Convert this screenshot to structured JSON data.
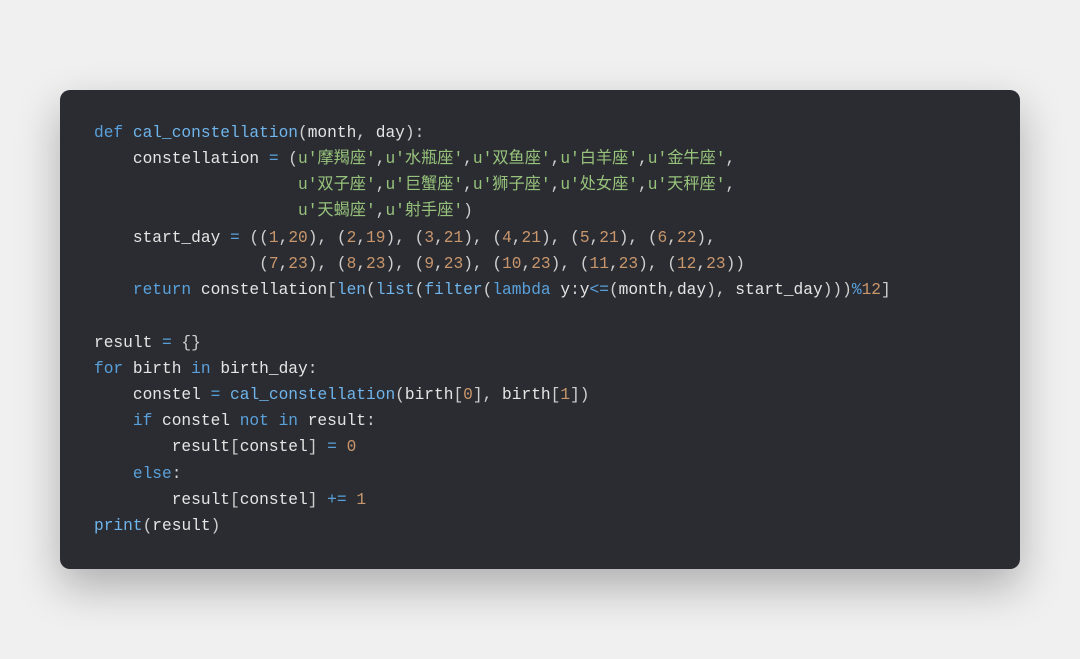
{
  "code": {
    "lines": [
      [
        {
          "cls": "t-def",
          "t": "def "
        },
        {
          "cls": "t-fn",
          "t": "cal_constellation"
        },
        {
          "cls": "t-punc",
          "t": "("
        },
        {
          "cls": "t-param",
          "t": "month"
        },
        {
          "cls": "t-punc",
          "t": ", "
        },
        {
          "cls": "t-param",
          "t": "day"
        },
        {
          "cls": "t-punc",
          "t": "):"
        }
      ],
      [
        {
          "cls": "t-var",
          "t": "    constellation "
        },
        {
          "cls": "t-op",
          "t": "="
        },
        {
          "cls": "t-punc",
          "t": " ("
        },
        {
          "cls": "t-str",
          "t": "u'摩羯座'"
        },
        {
          "cls": "t-punc",
          "t": ","
        },
        {
          "cls": "t-str",
          "t": "u'水瓶座'"
        },
        {
          "cls": "t-punc",
          "t": ","
        },
        {
          "cls": "t-str",
          "t": "u'双鱼座'"
        },
        {
          "cls": "t-punc",
          "t": ","
        },
        {
          "cls": "t-str",
          "t": "u'白羊座'"
        },
        {
          "cls": "t-punc",
          "t": ","
        },
        {
          "cls": "t-str",
          "t": "u'金牛座'"
        },
        {
          "cls": "t-punc",
          "t": ","
        }
      ],
      [
        {
          "cls": "t-punc",
          "t": "                     "
        },
        {
          "cls": "t-str",
          "t": "u'双子座'"
        },
        {
          "cls": "t-punc",
          "t": ","
        },
        {
          "cls": "t-str",
          "t": "u'巨蟹座'"
        },
        {
          "cls": "t-punc",
          "t": ","
        },
        {
          "cls": "t-str",
          "t": "u'狮子座'"
        },
        {
          "cls": "t-punc",
          "t": ","
        },
        {
          "cls": "t-str",
          "t": "u'处女座'"
        },
        {
          "cls": "t-punc",
          "t": ","
        },
        {
          "cls": "t-str",
          "t": "u'天秤座'"
        },
        {
          "cls": "t-punc",
          "t": ","
        }
      ],
      [
        {
          "cls": "t-punc",
          "t": "                     "
        },
        {
          "cls": "t-str",
          "t": "u'天蝎座'"
        },
        {
          "cls": "t-punc",
          "t": ","
        },
        {
          "cls": "t-str",
          "t": "u'射手座'"
        },
        {
          "cls": "t-punc",
          "t": ")"
        }
      ],
      [
        {
          "cls": "t-var",
          "t": "    start_day "
        },
        {
          "cls": "t-op",
          "t": "="
        },
        {
          "cls": "t-punc",
          "t": " (("
        },
        {
          "cls": "t-num",
          "t": "1"
        },
        {
          "cls": "t-punc",
          "t": ","
        },
        {
          "cls": "t-num",
          "t": "20"
        },
        {
          "cls": "t-punc",
          "t": "), ("
        },
        {
          "cls": "t-num",
          "t": "2"
        },
        {
          "cls": "t-punc",
          "t": ","
        },
        {
          "cls": "t-num",
          "t": "19"
        },
        {
          "cls": "t-punc",
          "t": "), ("
        },
        {
          "cls": "t-num",
          "t": "3"
        },
        {
          "cls": "t-punc",
          "t": ","
        },
        {
          "cls": "t-num",
          "t": "21"
        },
        {
          "cls": "t-punc",
          "t": "), ("
        },
        {
          "cls": "t-num",
          "t": "4"
        },
        {
          "cls": "t-punc",
          "t": ","
        },
        {
          "cls": "t-num",
          "t": "21"
        },
        {
          "cls": "t-punc",
          "t": "), ("
        },
        {
          "cls": "t-num",
          "t": "5"
        },
        {
          "cls": "t-punc",
          "t": ","
        },
        {
          "cls": "t-num",
          "t": "21"
        },
        {
          "cls": "t-punc",
          "t": "), ("
        },
        {
          "cls": "t-num",
          "t": "6"
        },
        {
          "cls": "t-punc",
          "t": ","
        },
        {
          "cls": "t-num",
          "t": "22"
        },
        {
          "cls": "t-punc",
          "t": "),"
        }
      ],
      [
        {
          "cls": "t-punc",
          "t": "                 ("
        },
        {
          "cls": "t-num",
          "t": "7"
        },
        {
          "cls": "t-punc",
          "t": ","
        },
        {
          "cls": "t-num",
          "t": "23"
        },
        {
          "cls": "t-punc",
          "t": "), ("
        },
        {
          "cls": "t-num",
          "t": "8"
        },
        {
          "cls": "t-punc",
          "t": ","
        },
        {
          "cls": "t-num",
          "t": "23"
        },
        {
          "cls": "t-punc",
          "t": "), ("
        },
        {
          "cls": "t-num",
          "t": "9"
        },
        {
          "cls": "t-punc",
          "t": ","
        },
        {
          "cls": "t-num",
          "t": "23"
        },
        {
          "cls": "t-punc",
          "t": "), ("
        },
        {
          "cls": "t-num",
          "t": "10"
        },
        {
          "cls": "t-punc",
          "t": ","
        },
        {
          "cls": "t-num",
          "t": "23"
        },
        {
          "cls": "t-punc",
          "t": "), ("
        },
        {
          "cls": "t-num",
          "t": "11"
        },
        {
          "cls": "t-punc",
          "t": ","
        },
        {
          "cls": "t-num",
          "t": "23"
        },
        {
          "cls": "t-punc",
          "t": "), ("
        },
        {
          "cls": "t-num",
          "t": "12"
        },
        {
          "cls": "t-punc",
          "t": ","
        },
        {
          "cls": "t-num",
          "t": "23"
        },
        {
          "cls": "t-punc",
          "t": "))"
        }
      ],
      [
        {
          "cls": "t-kw",
          "t": "    return "
        },
        {
          "cls": "t-var",
          "t": "constellation"
        },
        {
          "cls": "t-punc",
          "t": "["
        },
        {
          "cls": "t-bi",
          "t": "len"
        },
        {
          "cls": "t-punc",
          "t": "("
        },
        {
          "cls": "t-bi",
          "t": "list"
        },
        {
          "cls": "t-punc",
          "t": "("
        },
        {
          "cls": "t-bi",
          "t": "filter"
        },
        {
          "cls": "t-punc",
          "t": "("
        },
        {
          "cls": "t-kw",
          "t": "lambda "
        },
        {
          "cls": "t-var",
          "t": "y"
        },
        {
          "cls": "t-punc",
          "t": ":"
        },
        {
          "cls": "t-var",
          "t": "y"
        },
        {
          "cls": "t-op",
          "t": "<="
        },
        {
          "cls": "t-punc",
          "t": "("
        },
        {
          "cls": "t-var",
          "t": "month"
        },
        {
          "cls": "t-punc",
          "t": ","
        },
        {
          "cls": "t-var",
          "t": "day"
        },
        {
          "cls": "t-punc",
          "t": "), "
        },
        {
          "cls": "t-var",
          "t": "start_day"
        },
        {
          "cls": "t-punc",
          "t": ")))"
        },
        {
          "cls": "t-op",
          "t": "%"
        },
        {
          "cls": "t-num",
          "t": "12"
        },
        {
          "cls": "t-punc",
          "t": "]"
        }
      ],
      [
        {
          "cls": "t-punc",
          "t": ""
        }
      ],
      [
        {
          "cls": "t-var",
          "t": "result "
        },
        {
          "cls": "t-op",
          "t": "="
        },
        {
          "cls": "t-punc",
          "t": " {}"
        }
      ],
      [
        {
          "cls": "t-kw",
          "t": "for "
        },
        {
          "cls": "t-var",
          "t": "birth "
        },
        {
          "cls": "t-kw",
          "t": "in "
        },
        {
          "cls": "t-var",
          "t": "birth_day"
        },
        {
          "cls": "t-punc",
          "t": ":"
        }
      ],
      [
        {
          "cls": "t-var",
          "t": "    constel "
        },
        {
          "cls": "t-op",
          "t": "="
        },
        {
          "cls": "t-var",
          "t": " "
        },
        {
          "cls": "t-fn",
          "t": "cal_constellation"
        },
        {
          "cls": "t-punc",
          "t": "("
        },
        {
          "cls": "t-var",
          "t": "birth"
        },
        {
          "cls": "t-punc",
          "t": "["
        },
        {
          "cls": "t-num",
          "t": "0"
        },
        {
          "cls": "t-punc",
          "t": "], "
        },
        {
          "cls": "t-var",
          "t": "birth"
        },
        {
          "cls": "t-punc",
          "t": "["
        },
        {
          "cls": "t-num",
          "t": "1"
        },
        {
          "cls": "t-punc",
          "t": "])"
        }
      ],
      [
        {
          "cls": "t-kw",
          "t": "    if "
        },
        {
          "cls": "t-var",
          "t": "constel "
        },
        {
          "cls": "t-kw",
          "t": "not in "
        },
        {
          "cls": "t-var",
          "t": "result"
        },
        {
          "cls": "t-punc",
          "t": ":"
        }
      ],
      [
        {
          "cls": "t-var",
          "t": "        result"
        },
        {
          "cls": "t-punc",
          "t": "["
        },
        {
          "cls": "t-var",
          "t": "constel"
        },
        {
          "cls": "t-punc",
          "t": "] "
        },
        {
          "cls": "t-op",
          "t": "="
        },
        {
          "cls": "t-punc",
          "t": " "
        },
        {
          "cls": "t-num",
          "t": "0"
        }
      ],
      [
        {
          "cls": "t-kw",
          "t": "    else"
        },
        {
          "cls": "t-punc",
          "t": ":"
        }
      ],
      [
        {
          "cls": "t-var",
          "t": "        result"
        },
        {
          "cls": "t-punc",
          "t": "["
        },
        {
          "cls": "t-var",
          "t": "constel"
        },
        {
          "cls": "t-punc",
          "t": "] "
        },
        {
          "cls": "t-op",
          "t": "+="
        },
        {
          "cls": "t-punc",
          "t": " "
        },
        {
          "cls": "t-num",
          "t": "1"
        }
      ],
      [
        {
          "cls": "t-bi",
          "t": "print"
        },
        {
          "cls": "t-punc",
          "t": "("
        },
        {
          "cls": "t-var",
          "t": "result"
        },
        {
          "cls": "t-punc",
          "t": ")"
        }
      ]
    ]
  }
}
